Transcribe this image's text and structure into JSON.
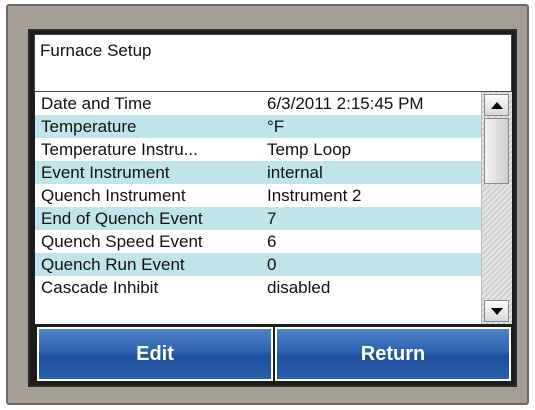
{
  "title": "Furnace Setup",
  "rows": [
    {
      "label": "Date and Time",
      "value": "6/3/2011 2:15:45 PM"
    },
    {
      "label": "Temperature",
      "value": "°F"
    },
    {
      "label": "Temperature Instru...",
      "value": "Temp Loop"
    },
    {
      "label": "Event Instrument",
      "value": "internal"
    },
    {
      "label": "Quench Instrument",
      "value": "Instrument 2"
    },
    {
      "label": "End of Quench Event",
      "value": "7"
    },
    {
      "label": "Quench Speed Event",
      "value": "6"
    },
    {
      "label": "Quench Run Event",
      "value": "0"
    },
    {
      "label": "Cascade Inhibit",
      "value": "disabled"
    }
  ],
  "buttons": {
    "edit": "Edit",
    "return": "Return"
  },
  "icons": {
    "scroll_up": "triangle-up-icon",
    "scroll_down": "triangle-down-icon"
  },
  "colors": {
    "alt_row": "#bfe4ea",
    "button": "#2e62b0",
    "bezel": "#a49e97"
  }
}
